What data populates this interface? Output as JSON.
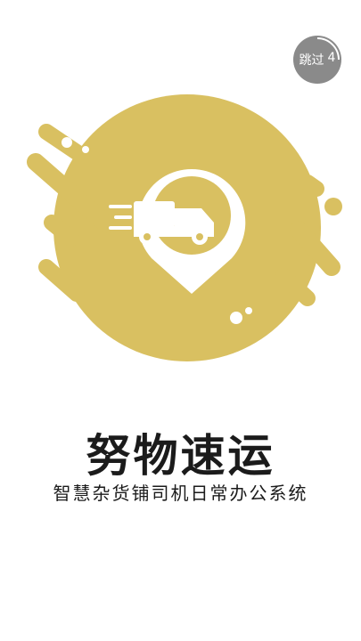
{
  "splash": {
    "skip_label": "跳过",
    "countdown": "4",
    "app_name": "努物速运",
    "tagline": "智慧杂货铺司机日常办公系统"
  },
  "colors": {
    "brand_gold": "#d9c061",
    "skip_bg": "#8a8a8a",
    "text": "#1b1b1b"
  },
  "icons": [
    "truck-icon",
    "location-pin-icon"
  ]
}
